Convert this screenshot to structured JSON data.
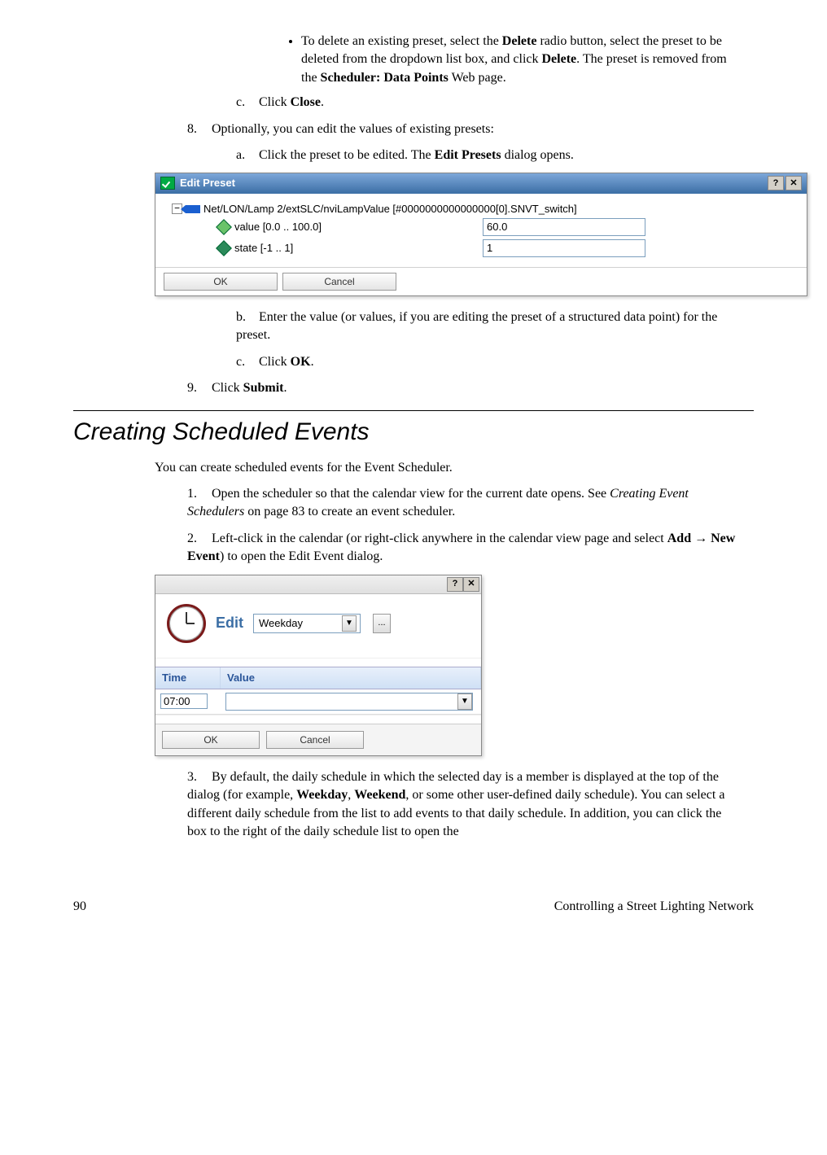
{
  "bullet_delete": [
    "To delete an existing preset, select the ",
    "Delete",
    " radio button, select the preset to be deleted from the dropdown list box, and click ",
    "Delete",
    ".  The preset is removed from the ",
    "Scheduler: Data Points",
    " Web page."
  ],
  "step_c": [
    "Click ",
    "Close",
    "."
  ],
  "step_8": "Optionally, you can edit the values of existing presets:",
  "step_8a": [
    "Click the preset to be edited.  The ",
    "Edit Presets",
    " dialog opens."
  ],
  "dialog_preset": {
    "title": "Edit Preset",
    "help": "?",
    "close": "✕",
    "root": "Net/LON/Lamp 2/extSLC/nviLampValue [#0000000000000000[0].SNVT_switch]",
    "rows": [
      {
        "label": "value [0.0 .. 100.0]",
        "value": "60.0"
      },
      {
        "label": "state [-1 .. 1]",
        "value": "1"
      }
    ],
    "ok": "OK",
    "cancel": "Cancel"
  },
  "step_8b": "Enter the value (or values, if you are editing the preset of a structured data point) for the preset.",
  "step_8c": [
    "Click ",
    "OK",
    "."
  ],
  "step_9": [
    "Click ",
    "Submit",
    "."
  ],
  "heading": "Creating Scheduled Events",
  "intro": "You can create scheduled events for the Event Scheduler.",
  "sched_1": [
    "Open the scheduler so that the calendar view for the current date opens. See ",
    "Creating Event Schedulers",
    " on page 83 to create an event scheduler."
  ],
  "sched_2": [
    "Left-click in the calendar (or right-click anywhere in the calendar view page and select ",
    "Add → New Event",
    ") to open the Edit Event dialog."
  ],
  "dialog_event": {
    "help": "?",
    "close": "✕",
    "edit_label": "Edit",
    "schedule": "Weekday",
    "more": "...",
    "col_time": "Time",
    "col_value": "Value",
    "time": "07:00",
    "value": "",
    "ok": "OK",
    "cancel": "Cancel"
  },
  "sched_3": [
    "By default, the daily schedule in which the selected day is a member is displayed at the top of the dialog (for example, ",
    "Weekday",
    ", ",
    "Weekend",
    ", or some other user-defined daily schedule).  You can select a different daily schedule from the list to add events to that daily schedule.  In addition, you can click the box to the right of the daily schedule list to open the"
  ],
  "footer_page": "90",
  "footer_title": "Controlling a Street Lighting Network"
}
